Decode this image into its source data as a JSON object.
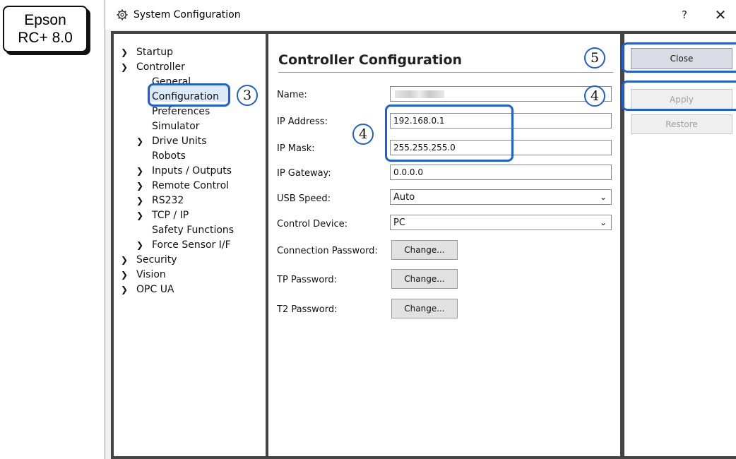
{
  "badge": {
    "line1": "Epson",
    "line2": "RC+ 8.0"
  },
  "window": {
    "title": "System Configuration",
    "help": "?",
    "close": "✕"
  },
  "tree": {
    "items": [
      {
        "label": "Startup",
        "arrow": "›"
      },
      {
        "label": "Controller",
        "arrow": "⌄"
      },
      {
        "label": "General"
      },
      {
        "label": "Configuration",
        "selected": true
      },
      {
        "label": "Preferences"
      },
      {
        "label": "Simulator"
      },
      {
        "label": "Drive Units",
        "arrow": "›"
      },
      {
        "label": "Robots"
      },
      {
        "label": "Inputs / Outputs",
        "arrow": "›"
      },
      {
        "label": "Remote Control",
        "arrow": "›"
      },
      {
        "label": "RS232",
        "arrow": "›"
      },
      {
        "label": "TCP / IP",
        "arrow": "›"
      },
      {
        "label": "Safety Functions"
      },
      {
        "label": "Force Sensor I/F",
        "arrow": "›"
      },
      {
        "label": "Security",
        "arrow": "›"
      },
      {
        "label": "Vision",
        "arrow": "›"
      },
      {
        "label": "OPC UA",
        "arrow": "›"
      }
    ]
  },
  "main": {
    "heading": "Controller Configuration",
    "fields": {
      "name_label": "Name:",
      "ip_address_label": "IP Address:",
      "ip_address_value": "192.168.0.1",
      "ip_mask_label": "IP Mask:",
      "ip_mask_value": "255.255.255.0",
      "ip_gateway_label": "IP Gateway:",
      "ip_gateway_value": "0.0.0.0",
      "usb_speed_label": "USB Speed:",
      "usb_speed_value": "Auto",
      "control_device_label": "Control Device:",
      "control_device_value": "PC",
      "connection_password_label": "Connection Password:",
      "tp_password_label": "TP Password:",
      "t2_password_label": "T2 Password:",
      "change_label": "Change..."
    }
  },
  "buttons": {
    "close": "Close",
    "apply": "Apply",
    "restore": "Restore"
  },
  "annotations": {
    "tree": "3",
    "ip": "4",
    "apply": "4",
    "close": "5"
  },
  "colors": {
    "annotation": "#1f5fd6",
    "selected_bg": "#dbe9f9"
  },
  "icons": {
    "title": "gear-icon",
    "chevron_down": "chevron-down-icon",
    "expand": "chevron-right-icon"
  }
}
